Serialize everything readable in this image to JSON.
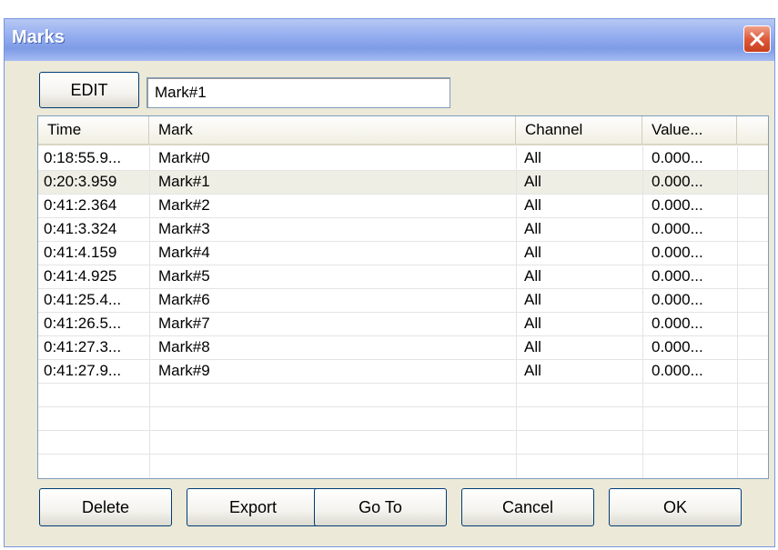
{
  "window": {
    "title": "Marks"
  },
  "toolbar": {
    "edit_label": "EDIT",
    "mark_value": "Mark#1"
  },
  "table": {
    "columns": [
      "Time",
      "Mark",
      "Channel",
      "Value..."
    ],
    "rows": [
      {
        "time": "0:18:55.9...",
        "mark": "Mark#0",
        "channel": "All",
        "value": "0.000..."
      },
      {
        "time": "0:20:3.959",
        "mark": "Mark#1",
        "channel": "All",
        "value": "0.000..."
      },
      {
        "time": "0:41:2.364",
        "mark": "Mark#2",
        "channel": "All",
        "value": "0.000..."
      },
      {
        "time": "0:41:3.324",
        "mark": "Mark#3",
        "channel": "All",
        "value": "0.000..."
      },
      {
        "time": "0:41:4.159",
        "mark": "Mark#4",
        "channel": "All",
        "value": "0.000..."
      },
      {
        "time": "0:41:4.925",
        "mark": "Mark#5",
        "channel": "All",
        "value": "0.000..."
      },
      {
        "time": "0:41:25.4...",
        "mark": "Mark#6",
        "channel": "All",
        "value": "0.000..."
      },
      {
        "time": "0:41:26.5...",
        "mark": "Mark#7",
        "channel": "All",
        "value": "0.000..."
      },
      {
        "time": "0:41:27.3...",
        "mark": "Mark#8",
        "channel": "All",
        "value": "0.000..."
      },
      {
        "time": "0:41:27.9...",
        "mark": "Mark#9",
        "channel": "All",
        "value": "0.000..."
      }
    ],
    "selected_row": 1
  },
  "buttons": {
    "delete": "Delete",
    "export": "Export",
    "goto": "Go To",
    "cancel": "Cancel",
    "ok": "OK"
  },
  "icons": {
    "close": "close-icon"
  },
  "colors": {
    "titlebar": "#95aef0",
    "close": "#de5a3a",
    "dialog": "#ece9d8",
    "selected_row": "#efeee5"
  }
}
